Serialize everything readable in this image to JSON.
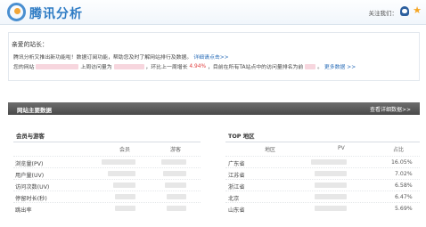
{
  "header": {
    "brand": "腾讯分析",
    "follow": "关注我们："
  },
  "welcome": {
    "greeting": "亲爱的站长：",
    "line1": "腾讯分析又推出新功能啦！数据订阅功能，帮助您及时了解网站排行及数据。",
    "line1_link": "详细请点击>>",
    "line2_a": "您的网站",
    "line2_b": "上周访问量为",
    "line2_c": "，环比上一周增长",
    "line2_growth": "4.94%",
    "line2_d": "，目前在所有TA站点中的访问量排名为前",
    "line2_e": "。",
    "line2_more": "更多数据 >>"
  },
  "main": {
    "title": "网站主要数据",
    "detail_link": "查看详细数据>>"
  },
  "visitors": {
    "title": "会员与游客",
    "columns": [
      "会员",
      "游客"
    ],
    "rows": [
      {
        "label": "浏览量(PV)"
      },
      {
        "label": "用户量(UV)"
      },
      {
        "label": "访问次数(UV)"
      },
      {
        "label": "停留时长(秒)"
      },
      {
        "label": "跳出率"
      }
    ]
  },
  "regions": {
    "title": "TOP 地区",
    "columns": [
      "地区",
      "PV",
      "占比"
    ],
    "rows": [
      {
        "region": "广东省",
        "share": "16.05%"
      },
      {
        "region": "江苏省",
        "share": "7.02%"
      },
      {
        "region": "浙江省",
        "share": "6.58%"
      },
      {
        "region": "北京",
        "share": "6.47%"
      },
      {
        "region": "山东省",
        "share": "5.69%"
      }
    ]
  }
}
